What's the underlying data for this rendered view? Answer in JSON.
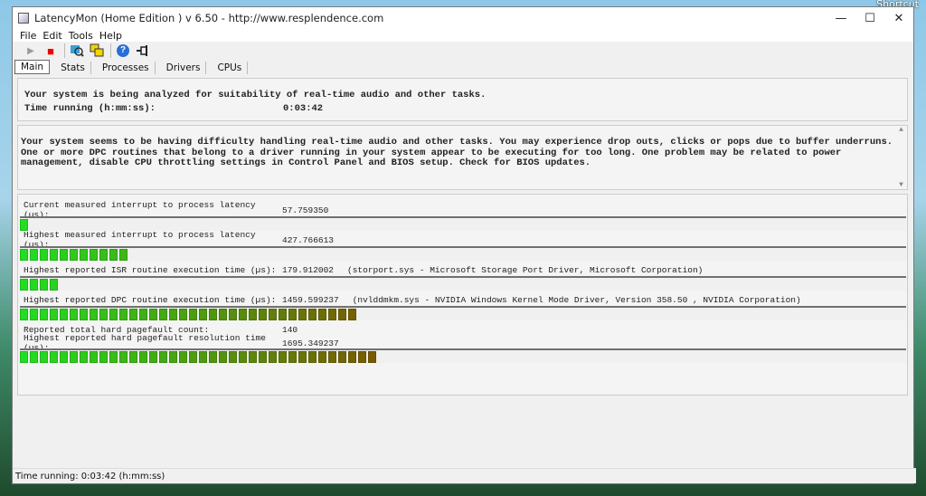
{
  "desktop": {
    "shortcut_label": "Shortcut"
  },
  "window": {
    "title": "LatencyMon  (Home Edition )  v 6.50 - http://www.resplendence.com",
    "controls": {
      "minimize": "—",
      "maximize": "☐",
      "close": "✕"
    }
  },
  "menu": [
    "File",
    "Edit",
    "Tools",
    "Help"
  ],
  "toolbar": {
    "play": "▶",
    "stop": "■",
    "help": "?"
  },
  "tabs": [
    "Main",
    "Stats",
    "Processes",
    "Drivers",
    "CPUs"
  ],
  "status": {
    "line": "Your system is being analyzed for suitability of real-time audio and other tasks.",
    "time_label": "Time running (h:mm:ss):",
    "time_value": "0:03:42"
  },
  "message": "Your system seems to be having difficulty handling real-time audio and other tasks. You may experience drop outs, clicks or pops due to buffer underruns. One or more DPC routines that belong to a driver running in your system appear to be executing for too long. One problem may be related to power management, disable CPU throttling settings in Control Panel and BIOS setup. Check for BIOS updates.",
  "metrics": [
    {
      "label": "Current measured interrupt to process latency (µs):",
      "value": "57.759350",
      "note": "",
      "segments": 1
    },
    {
      "label": "Highest measured interrupt to process latency (µs):",
      "value": "427.766613",
      "note": "",
      "segments": 11
    },
    {
      "label": "Highest reported ISR routine execution time (µs):",
      "value": "179.912002",
      "note": "(storport.sys - Microsoft Storage Port Driver, Microsoft Corporation)",
      "segments": 4
    },
    {
      "label": "Highest reported DPC routine execution time (µs):",
      "value": "1459.599237",
      "note": "(nvlddmkm.sys - NVIDIA Windows Kernel Mode Driver, Version 358.50 , NVIDIA Corporation)",
      "segments": 34
    },
    {
      "label": "Reported total hard pagefault count:",
      "value": "140",
      "note": ""
    },
    {
      "label": "Highest reported hard pagefault resolution time (µs):",
      "value": "1695.349237",
      "note": "",
      "segments": 36
    }
  ],
  "colors": {
    "bar_start": "#22dd22",
    "bar_end": "#7a5a00"
  },
  "statusbar": "Time running: 0:03:42  (h:mm:ss)"
}
